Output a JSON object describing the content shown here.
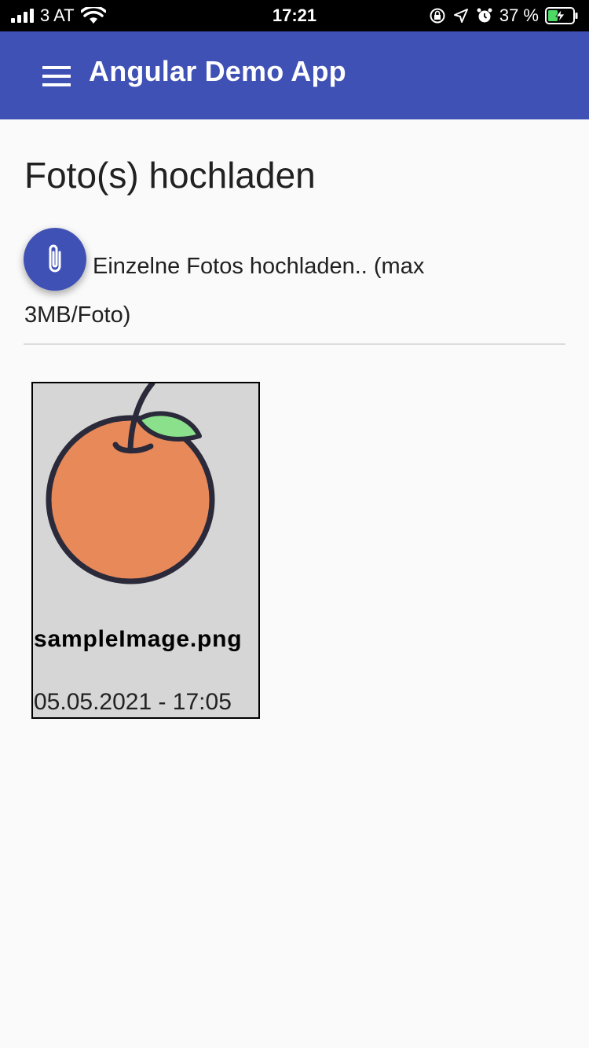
{
  "status_bar": {
    "carrier": "3 AT",
    "time": "17:21",
    "battery_percent": "37 %"
  },
  "app_bar": {
    "title": "Angular Demo App",
    "menu_icon": "hamburger-menu-icon",
    "color": "#3f51b5"
  },
  "page": {
    "title": "Foto(s) hochladen",
    "upload_label": "Einzelne Fotos hochladen.. (max 3MB/Foto)",
    "upload_icon": "paperclip-icon"
  },
  "photos": [
    {
      "filename": "sampleImage.png",
      "date": "05.05.2021 - 17:05",
      "thumbnail": "orange-fruit-image"
    }
  ]
}
